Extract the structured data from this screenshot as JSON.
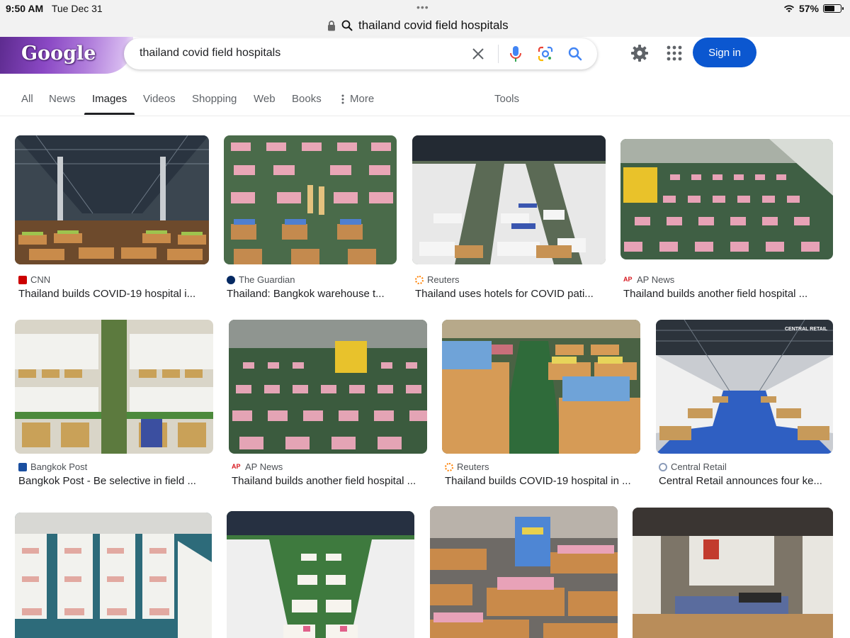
{
  "status": {
    "time": "9:50 AM",
    "date": "Tue Dec 31",
    "dots": "•••",
    "battery": "57%"
  },
  "url_bar": {
    "text": "thailand covid field hospitals"
  },
  "logo": {
    "text": "Google"
  },
  "search": {
    "query": "thailand covid field hospitals"
  },
  "header": {
    "signin": "Sign in"
  },
  "tabs": {
    "all": "All",
    "news": "News",
    "images": "Images",
    "videos": "Videos",
    "shopping": "Shopping",
    "web": "Web",
    "books": "Books",
    "more": "More",
    "tools": "Tools"
  },
  "results": [
    {
      "source": "CNN",
      "caption": "Thailand builds COVID-19 hospital i...",
      "favicon_color": "#cc0000"
    },
    {
      "source": "The Guardian",
      "caption": "Thailand: Bangkok warehouse t...",
      "favicon_color": "#052962"
    },
    {
      "source": "Reuters",
      "caption": "Thailand uses hotels for COVID pati...",
      "favicon_color": "#ff8000"
    },
    {
      "source": "AP News",
      "caption": "Thailand builds another field hospital ...",
      "favicon_color": "#d71920"
    },
    {
      "source": "Bangkok Post",
      "caption": "Bangkok Post - Be selective in field ...",
      "favicon_color": "#1a4fa0"
    },
    {
      "source": "AP News",
      "caption": "Thailand builds another field hospital ...",
      "favicon_color": "#d71920"
    },
    {
      "source": "Reuters",
      "caption": "Thailand builds COVID-19 hospital in ...",
      "favicon_color": "#ff8000"
    },
    {
      "source": "Central Retail",
      "caption": "Central Retail announces four ke...",
      "favicon_color": "#8a9bb8"
    },
    {
      "source": "",
      "caption": "",
      "favicon_color": ""
    },
    {
      "source": "",
      "caption": "",
      "favicon_color": ""
    },
    {
      "source": "",
      "caption": "",
      "favicon_color": ""
    },
    {
      "source": "",
      "caption": "",
      "favicon_color": ""
    }
  ],
  "watermarks": {
    "central_retail": "CENTRAL RETAIL"
  }
}
